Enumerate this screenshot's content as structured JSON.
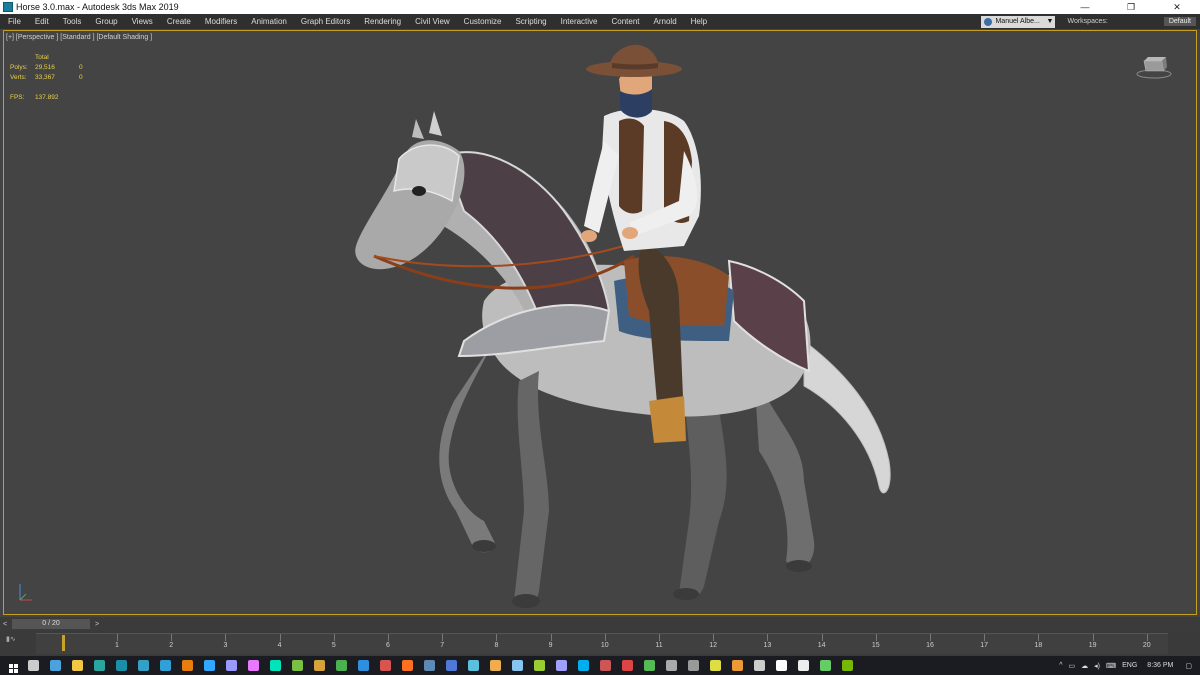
{
  "window": {
    "title": "Horse 3.0.max - Autodesk 3ds Max 2019",
    "minimize": "—",
    "restore": "❐",
    "close": "✕"
  },
  "menu": {
    "items": [
      "File",
      "Edit",
      "Tools",
      "Group",
      "Views",
      "Create",
      "Modifiers",
      "Animation",
      "Graph Editors",
      "Rendering",
      "Civil View",
      "Customize",
      "Scripting",
      "Interactive",
      "Content",
      "Arnold",
      "Help"
    ],
    "user": "Manuel Albe...",
    "workspaces_label": "Workspaces:",
    "workspace_value": "Default"
  },
  "viewport": {
    "label": "[+] [Perspective ] [Standard ] [Default Shading ]",
    "stats": {
      "header": "Total",
      "polys_label": "Polys:",
      "polys_total": "29,516",
      "polys_sel": "0",
      "verts_label": "Verts:",
      "verts_total": "33,367",
      "verts_sel": "0",
      "fps_label": "FPS:",
      "fps_value": "137.892"
    }
  },
  "timeline": {
    "prev": "<",
    "next": ">",
    "frame_display": "0 / 20",
    "ticks": [
      "1",
      "2",
      "3",
      "4",
      "5",
      "6",
      "7",
      "8",
      "9",
      "10",
      "11",
      "12",
      "13",
      "14",
      "15",
      "16",
      "17",
      "18",
      "19",
      "20"
    ],
    "current_frame": 0
  },
  "taskbar": {
    "icons": [
      "start-icon",
      "task-view-icon",
      "save-icon",
      "file-explorer-icon",
      "app-icon-1",
      "3dsmax-icon",
      "app-icon-2",
      "app-icon-3",
      "blender-icon",
      "photoshop-icon",
      "after-effects-icon",
      "premiere-icon",
      "audition-icon",
      "app-icon-4",
      "app-icon-5",
      "chrome-icon",
      "app-icon-6",
      "app-icon-7",
      "app-icon-8",
      "steam-icon",
      "vb-icon",
      "app-icon-9",
      "app-icon-10",
      "app-icon-11",
      "app-icon-12",
      "app-icon-13",
      "skype-icon",
      "app-icon-14",
      "app-icon-15",
      "app-icon-16",
      "app-icon-17",
      "app-icon-18",
      "app-icon-19",
      "app-icon-20",
      "app-icon-21",
      "app-icon-22",
      "app-icon-23",
      "app-icon-24",
      "nvidia-icon"
    ],
    "icon_colors": [
      "#ffffff",
      "#cccccc",
      "#4aa3df",
      "#f2c744",
      "#2aa6a0",
      "#1a8fa8",
      "#33a0c8",
      "#31a0d8",
      "#e87d0d",
      "#31a8ff",
      "#9999ff",
      "#ea77ff",
      "#00e4bb",
      "#7ac143",
      "#d8a23a",
      "#4caf50",
      "#2d8fe0",
      "#d9534f",
      "#ff6f20",
      "#5d8ab4",
      "#4f79d8",
      "#5bc0de",
      "#f0ad4e",
      "#86c5f0",
      "#9acd32",
      "#a0a0ff",
      "#00aff0",
      "#cc5555",
      "#dd4444",
      "#55bb55",
      "#aaaaaa",
      "#999999",
      "#dddd44",
      "#ee9933",
      "#cccccc",
      "#ffffff",
      "#eeeeee",
      "#66cc66",
      "#76b900"
    ],
    "tray_symbols": [
      "^",
      "▭",
      "☁",
      "◂)",
      "⌨",
      "ENG"
    ],
    "clock": "8:36 PM",
    "notification": "▢"
  }
}
